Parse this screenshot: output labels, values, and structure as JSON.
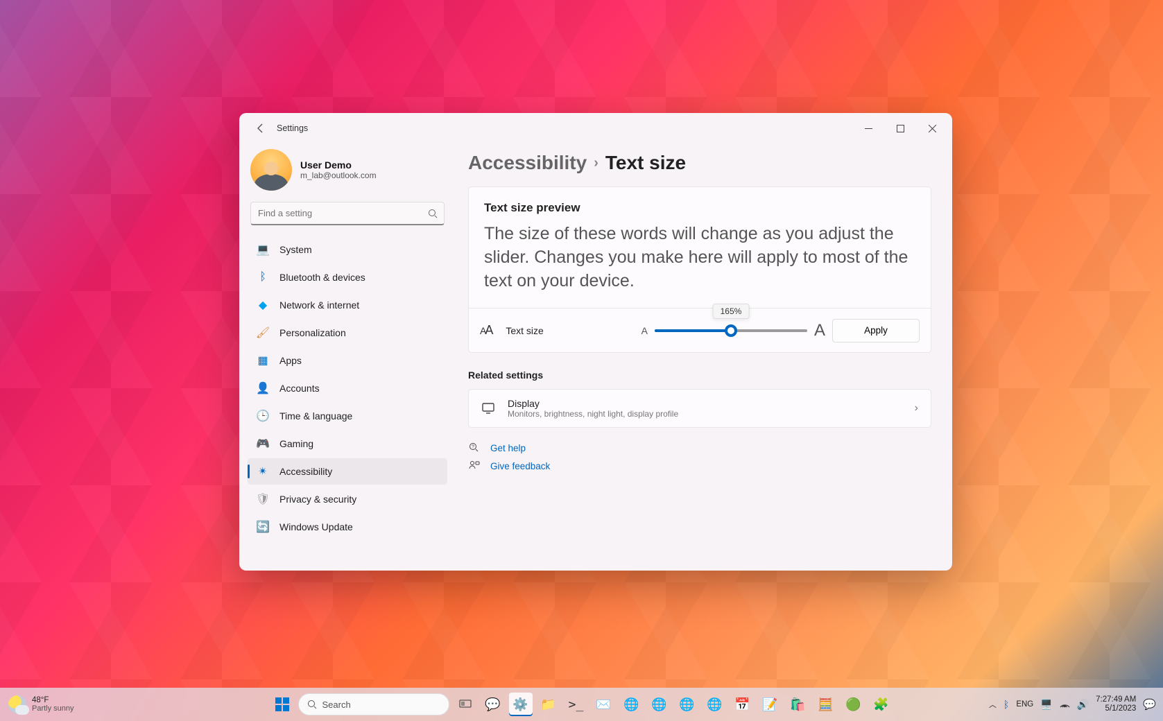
{
  "window": {
    "title": "Settings",
    "user_name": "User Demo",
    "user_email": "m_lab@outlook.com",
    "search_placeholder": "Find a setting"
  },
  "nav": [
    {
      "label": "System",
      "icon": "💻",
      "color": "#0067c0"
    },
    {
      "label": "Bluetooth & devices",
      "icon": "ᛒ",
      "color": "#0067c0"
    },
    {
      "label": "Network & internet",
      "icon": "◆",
      "color": "#00a2ed"
    },
    {
      "label": "Personalization",
      "icon": "🖌",
      "color": "#e08a3c"
    },
    {
      "label": "Apps",
      "icon": "▦",
      "color": "#0067c0"
    },
    {
      "label": "Accounts",
      "icon": "👤",
      "color": "#3a8f3a"
    },
    {
      "label": "Time & language",
      "icon": "🕒",
      "color": "#3fa9c9"
    },
    {
      "label": "Gaming",
      "icon": "🎮",
      "color": "#888"
    },
    {
      "label": "Accessibility",
      "icon": "✴",
      "color": "#0067c0",
      "active": true
    },
    {
      "label": "Privacy & security",
      "icon": "🛡",
      "color": "#999"
    },
    {
      "label": "Windows Update",
      "icon": "🔄",
      "color": "#0067c0"
    }
  ],
  "breadcrumb": {
    "parent": "Accessibility",
    "current": "Text size"
  },
  "preview": {
    "title": "Text size preview",
    "text": "The size of these words will change as you adjust the slider. Changes you make here will apply to most of the text on your device."
  },
  "slider": {
    "label": "Text size",
    "value_pct": 50,
    "tooltip": "165%",
    "apply": "Apply"
  },
  "related": {
    "title": "Related settings",
    "display_title": "Display",
    "display_sub": "Monitors, brightness, night light, display profile"
  },
  "help": {
    "get_help": "Get help",
    "feedback": "Give feedback"
  },
  "taskbar": {
    "weather_temp": "48°F",
    "weather_desc": "Partly sunny",
    "search_placeholder": "Search",
    "lang": "ENG",
    "time": "7:27:49 AM",
    "date": "5/1/2023"
  }
}
